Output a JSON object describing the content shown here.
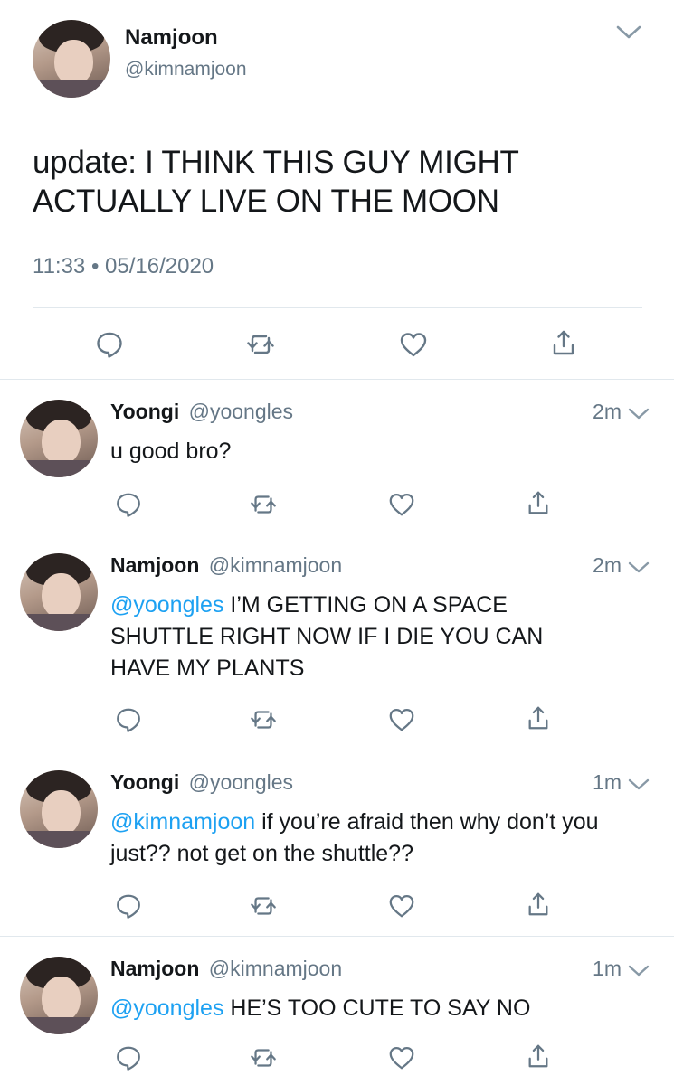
{
  "main_tweet": {
    "name": "Namjoon",
    "handle": "@kimnamjoon",
    "text": "update: I THINK THIS GUY MIGHT ACTUALLY LIVE ON THE MOON",
    "timestamp": "11:33 • 05/16/2020"
  },
  "replies": [
    {
      "name": "Yoongi",
      "handle": "@yoongles",
      "time": "2m",
      "mention": "",
      "text": "u good bro?"
    },
    {
      "name": "Namjoon",
      "handle": "@kimnamjoon",
      "time": "2m",
      "mention": "@yoongles",
      "text": " I’M GETTING ON A SPACE SHUTTLE RIGHT NOW IF I DIE YOU CAN HAVE MY PLANTS"
    },
    {
      "name": "Yoongi",
      "handle": "@yoongles",
      "time": "1m",
      "mention": "@kimnamjoon",
      "text": " if you’re afraid then why don’t you just?? not get on the shuttle??"
    },
    {
      "name": "Namjoon",
      "handle": "@kimnamjoon",
      "time": "1m",
      "mention": "@yoongles",
      "text": " HE’S TOO CUTE TO SAY NO"
    }
  ],
  "icons": {
    "reply": "reply-bubble-icon",
    "retweet": "retweet-icon",
    "like": "heart-icon",
    "share": "share-icon",
    "menu": "chevron-down-icon"
  },
  "colors": {
    "mention": "#1da1f2",
    "secondary_text": "#657786",
    "icon": "#657786",
    "divider": "#e1e8ed"
  }
}
